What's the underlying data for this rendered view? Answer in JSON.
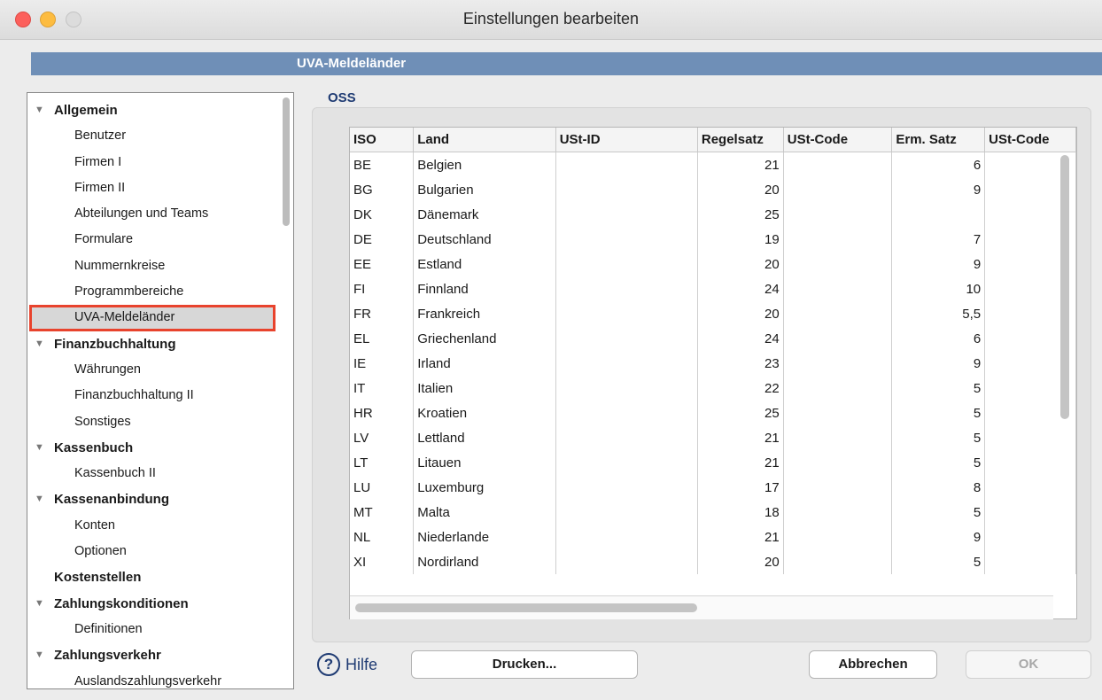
{
  "window": {
    "title": "Einstellungen bearbeiten"
  },
  "section": {
    "title": "UVA-Meldeländer"
  },
  "sidebar": {
    "items": [
      {
        "label": "Allgemein",
        "kind": "group"
      },
      {
        "label": "Benutzer",
        "kind": "child"
      },
      {
        "label": "Firmen I",
        "kind": "child"
      },
      {
        "label": "Firmen II",
        "kind": "child"
      },
      {
        "label": "Abteilungen und Teams",
        "kind": "child"
      },
      {
        "label": "Formulare",
        "kind": "child"
      },
      {
        "label": "Nummernkreise",
        "kind": "child"
      },
      {
        "label": "Programmbereiche",
        "kind": "child"
      },
      {
        "label": "UVA-Meldeländer",
        "kind": "child",
        "selected": true
      },
      {
        "label": "Finanzbuchhaltung",
        "kind": "group"
      },
      {
        "label": "Währungen",
        "kind": "child"
      },
      {
        "label": "Finanzbuchhaltung II",
        "kind": "child"
      },
      {
        "label": "Sonstiges",
        "kind": "child"
      },
      {
        "label": "Kassenbuch",
        "kind": "group"
      },
      {
        "label": "Kassenbuch II",
        "kind": "child"
      },
      {
        "label": "Kassenanbindung",
        "kind": "group"
      },
      {
        "label": "Konten",
        "kind": "child"
      },
      {
        "label": "Optionen",
        "kind": "child"
      },
      {
        "label": "Kostenstellen",
        "kind": "plain"
      },
      {
        "label": "Zahlungskonditionen",
        "kind": "group"
      },
      {
        "label": "Definitionen",
        "kind": "child"
      },
      {
        "label": "Zahlungsverkehr",
        "kind": "group"
      },
      {
        "label": "Auslandszahlungsverkehr",
        "kind": "child"
      }
    ]
  },
  "oss": {
    "label": "OSS",
    "columns": [
      "ISO",
      "Land",
      "USt-ID",
      "Regelsatz",
      "USt-Code",
      "Erm. Satz",
      "USt-Code"
    ],
    "rows": [
      [
        "BE",
        "Belgien",
        "",
        "21",
        "",
        "6",
        ""
      ],
      [
        "BG",
        "Bulgarien",
        "",
        "20",
        "",
        "9",
        ""
      ],
      [
        "DK",
        "Dänemark",
        "",
        "25",
        "",
        "",
        ""
      ],
      [
        "DE",
        "Deutschland",
        "",
        "19",
        "",
        "7",
        ""
      ],
      [
        "EE",
        "Estland",
        "",
        "20",
        "",
        "9",
        ""
      ],
      [
        "FI",
        "Finnland",
        "",
        "24",
        "",
        "10",
        ""
      ],
      [
        "FR",
        "Frankreich",
        "",
        "20",
        "",
        "5,5",
        ""
      ],
      [
        "EL",
        "Griechenland",
        "",
        "24",
        "",
        "6",
        ""
      ],
      [
        "IE",
        "Irland",
        "",
        "23",
        "",
        "9",
        ""
      ],
      [
        "IT",
        "Italien",
        "",
        "22",
        "",
        "5",
        ""
      ],
      [
        "HR",
        "Kroatien",
        "",
        "25",
        "",
        "5",
        ""
      ],
      [
        "LV",
        "Lettland",
        "",
        "21",
        "",
        "5",
        ""
      ],
      [
        "LT",
        "Litauen",
        "",
        "21",
        "",
        "5",
        ""
      ],
      [
        "LU",
        "Luxemburg",
        "",
        "17",
        "",
        "8",
        ""
      ],
      [
        "MT",
        "Malta",
        "",
        "18",
        "",
        "5",
        ""
      ],
      [
        "NL",
        "Niederlande",
        "",
        "21",
        "",
        "9",
        ""
      ],
      [
        "XI",
        "Nordirland",
        "",
        "20",
        "",
        "5",
        ""
      ]
    ]
  },
  "footer": {
    "help_icon": "?",
    "help_label": "Hilfe",
    "print_label": "Drucken...",
    "cancel_label": "Abbrechen",
    "ok_label": "OK"
  }
}
